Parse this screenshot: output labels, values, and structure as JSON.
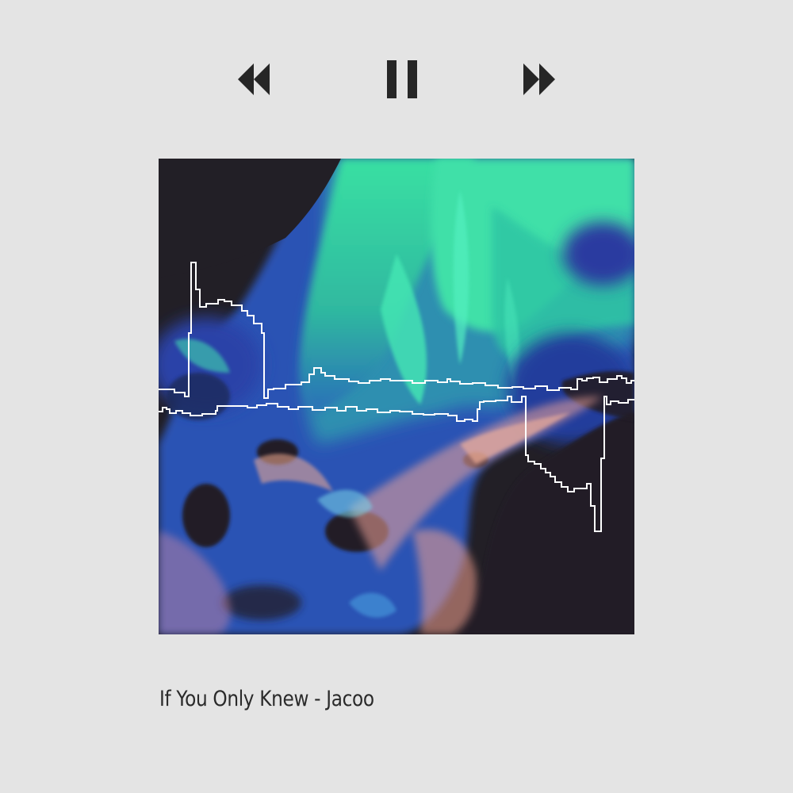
{
  "controls": {
    "previous_icon": "rewind-icon",
    "pause_icon": "pause-icon",
    "next_icon": "fast-forward-icon",
    "icon_color": "#262626"
  },
  "artwork": {
    "waveform_color": "#ffffff"
  },
  "track": {
    "title": "If You Only Knew - Jacoo"
  },
  "theme": {
    "background": "#e4e4e4"
  }
}
